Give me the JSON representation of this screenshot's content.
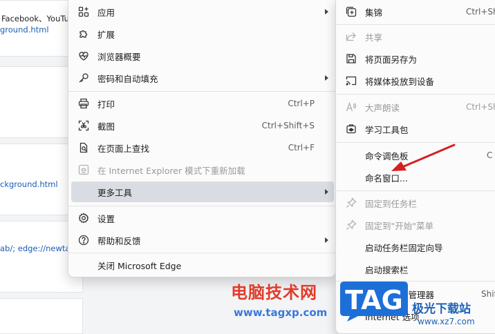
{
  "background": {
    "cards": [
      {
        "text": "Facebook、YouTu",
        "link": "ground.html"
      },
      {
        "link": "ckground.html"
      },
      {
        "link": "ab/; edge://newta"
      }
    ]
  },
  "menu": {
    "items": [
      {
        "label": "应用",
        "icon": "apps-icon",
        "shortcut": "",
        "submenu": true,
        "disabled": false
      },
      {
        "label": "扩展",
        "icon": "puzzle-icon",
        "shortcut": "",
        "submenu": false,
        "disabled": false
      },
      {
        "label": "浏览器概要",
        "icon": "heartbeat-icon",
        "shortcut": "",
        "submenu": false,
        "disabled": false
      },
      {
        "label": "密码和自动填充",
        "icon": "key-icon",
        "shortcut": "",
        "submenu": true,
        "disabled": false
      },
      {
        "label": "打印",
        "icon": "printer-icon",
        "shortcut": "Ctrl+P",
        "submenu": false,
        "disabled": false
      },
      {
        "label": "截图",
        "icon": "screenshot-icon",
        "shortcut": "Ctrl+Shift+S",
        "submenu": false,
        "disabled": false
      },
      {
        "label": "在页面上查找",
        "icon": "find-icon",
        "shortcut": "Ctrl+F",
        "submenu": false,
        "disabled": false
      },
      {
        "label": "在 Internet Explorer 模式下重新加载",
        "icon": "ie-icon",
        "shortcut": "",
        "submenu": false,
        "disabled": true
      },
      {
        "label": "更多工具",
        "icon": "",
        "shortcut": "",
        "submenu": true,
        "disabled": false,
        "highlighted": true
      },
      {
        "label": "设置",
        "icon": "gear-icon",
        "shortcut": "",
        "submenu": false,
        "disabled": false
      },
      {
        "label": "帮助和反馈",
        "icon": "help-icon",
        "shortcut": "",
        "submenu": true,
        "disabled": false
      },
      {
        "label": "关闭 Microsoft Edge",
        "icon": "",
        "shortcut": "",
        "submenu": false,
        "disabled": false
      }
    ]
  },
  "submenu": {
    "items": [
      {
        "label": "集锦",
        "icon": "collections-icon",
        "shortcut": "Ctrl+Sh",
        "disabled": false
      },
      {
        "label": "共享",
        "icon": "share-icon",
        "shortcut": "",
        "disabled": true
      },
      {
        "label": "将页面另存为",
        "icon": "save-icon",
        "shortcut": "",
        "disabled": false
      },
      {
        "label": "将媒体投放到设备",
        "icon": "cast-icon",
        "shortcut": "",
        "disabled": false
      },
      {
        "label": "大声朗读",
        "icon": "read-aloud-icon",
        "shortcut": "Ctrl+Sh",
        "disabled": true
      },
      {
        "label": "学习工具包",
        "icon": "learning-toolkit-icon",
        "shortcut": "",
        "disabled": false
      },
      {
        "label": "命令调色板",
        "icon": "",
        "shortcut": "C",
        "disabled": false
      },
      {
        "label": "命名窗口...",
        "icon": "",
        "shortcut": "",
        "disabled": false
      },
      {
        "label": "固定到任务栏",
        "icon": "pin-icon",
        "shortcut": "",
        "disabled": true
      },
      {
        "label": "固定到\"开始\"菜单",
        "icon": "pin-icon",
        "shortcut": "",
        "disabled": true
      },
      {
        "label": "启动任务栏固定向导",
        "icon": "",
        "shortcut": "",
        "disabled": false
      },
      {
        "label": "启动搜索栏",
        "icon": "",
        "shortcut": "",
        "disabled": false
      },
      {
        "label": "浏览器任务管理器",
        "icon": "",
        "shortcut": "Shif",
        "disabled": false
      },
      {
        "label": "Internet 选项",
        "icon": "",
        "shortcut": "",
        "disabled": false
      }
    ]
  },
  "annotation": {
    "type": "red-arrow",
    "target": "命名窗口..."
  },
  "watermark": {
    "site_cn": "电脑技术网",
    "site_url": "www.tagxp.com",
    "logo_text": "TAG",
    "brand_cn": "极光下载站",
    "brand_url": "www.xz7.com"
  },
  "colors": {
    "highlight": "#d9dde3",
    "disabled_text": "#9a9a9a",
    "arrow": "#d42020",
    "logo_blue": "#1d6fd8"
  }
}
